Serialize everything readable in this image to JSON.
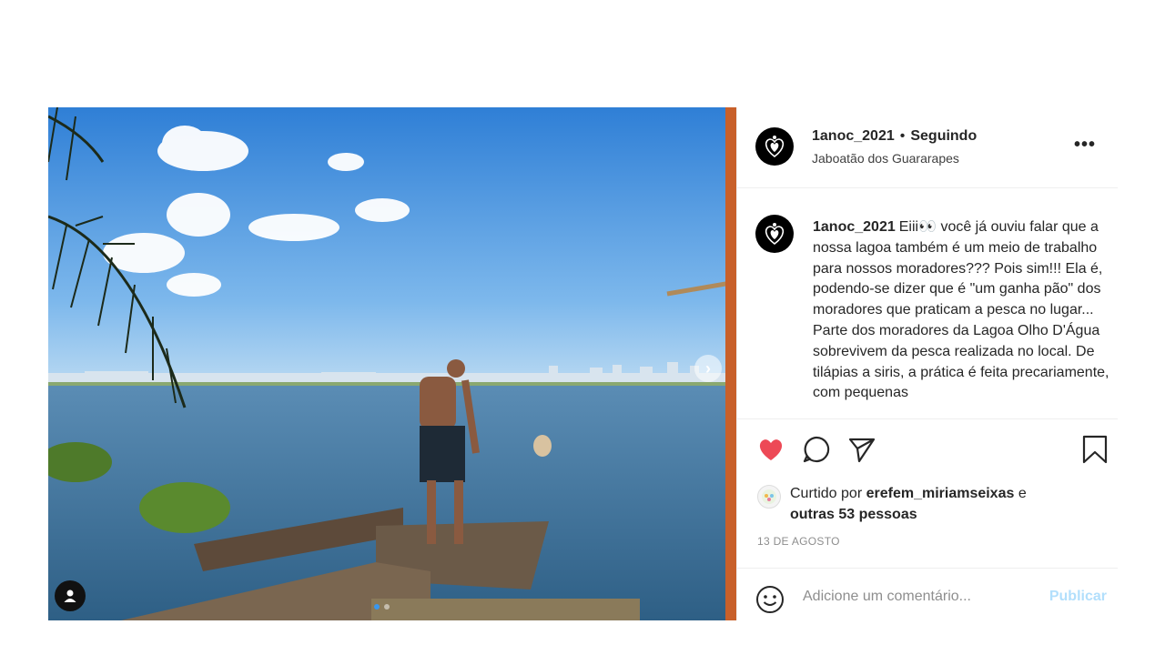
{
  "post": {
    "username": "1anoc_2021",
    "separator": "•",
    "follow_status": "Seguindo",
    "location": "Jaboatão dos Guararapes",
    "more_icon": "more-options-icon",
    "caption_username": "1anoc_2021",
    "caption_text": "Eiii👀 você já ouviu falar que a nossa lagoa também é um meio de trabalho para nossos moradores??? Pois sim!!! Ela é, podendo-se dizer que é \"um ganha pão\" dos moradores que praticam a pesca no lugar... Parte dos moradores da Lagoa Olho D'Água sobrevivem da pesca realizada no local. De tilápias a siris, a prática é feita precariamente, com pequenas",
    "likes_prefix": "Curtido por ",
    "liked_by": "erefem_miriamseixas",
    "likes_connector": " e",
    "likes_others": "outras 53 pessoas",
    "date": "13 DE AGOSTO",
    "comment_placeholder": "Adicione um comentário...",
    "publish_label": "Publicar",
    "liked": true,
    "carousel": {
      "total_slides": 2,
      "current_slide": 1
    }
  },
  "colors": {
    "heart": "#ed4956",
    "publish_disabled": "#b2dffc",
    "active_dot": "#3897f0"
  }
}
